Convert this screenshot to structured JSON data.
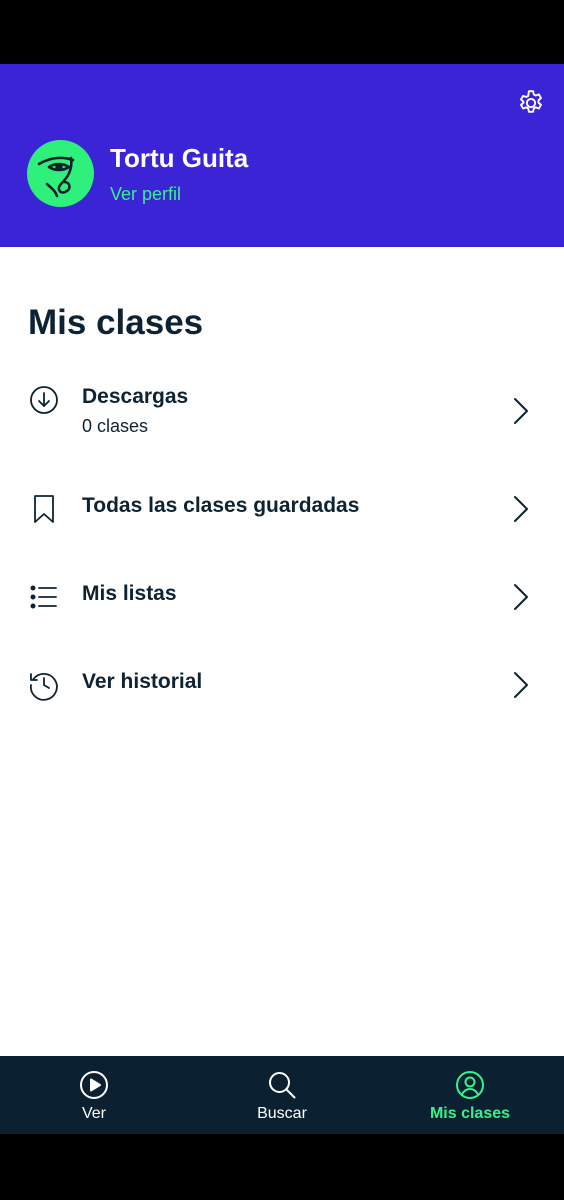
{
  "header": {
    "user_name": "Tortu Guita",
    "view_profile_label": "Ver perfil",
    "settings_icon": "gear-icon",
    "avatar_bg": "#2ff07a",
    "header_bg": "#3b24d6"
  },
  "main": {
    "title": "Mis clases",
    "items": [
      {
        "title": "Descargas",
        "subtitle": "0 clases",
        "icon": "download-icon"
      },
      {
        "title": "Todas las clases guardadas",
        "icon": "bookmark-icon"
      },
      {
        "title": "Mis listas",
        "icon": "list-icon"
      },
      {
        "title": "Ver historial",
        "icon": "history-icon"
      }
    ]
  },
  "nav": {
    "items": [
      {
        "label": "Ver",
        "icon": "play-icon",
        "active": false
      },
      {
        "label": "Buscar",
        "icon": "search-icon",
        "active": false
      },
      {
        "label": "Mis clases",
        "icon": "profile-icon",
        "active": true
      }
    ],
    "active_color": "#34f38a"
  }
}
